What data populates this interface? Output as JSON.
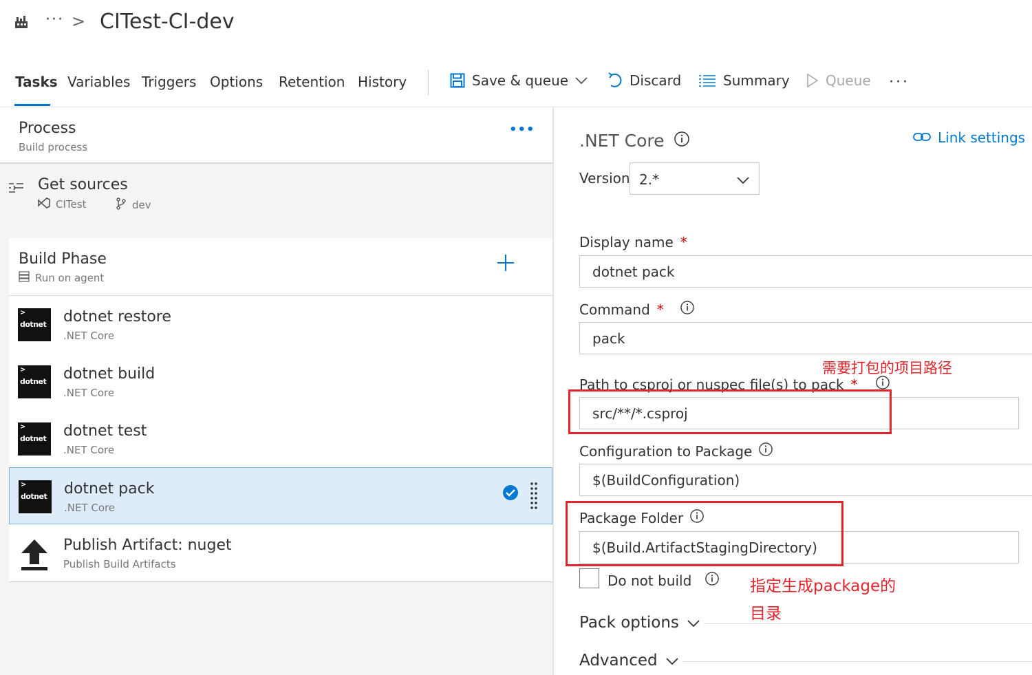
{
  "header": {
    "ellipsis": "···",
    "chevron": ">",
    "title": "CITest-CI-dev"
  },
  "tabs": [
    {
      "label": "Tasks",
      "active": true
    },
    {
      "label": "Variables"
    },
    {
      "label": "Triggers"
    },
    {
      "label": "Options"
    },
    {
      "label": "Retention"
    },
    {
      "label": "History"
    }
  ],
  "toolbar": {
    "save_queue": "Save & queue",
    "discard": "Discard",
    "summary": "Summary",
    "queue": "Queue",
    "more": "···"
  },
  "process": {
    "title": "Process",
    "subtitle": "Build process",
    "more": "•••"
  },
  "sources": {
    "title": "Get sources",
    "repo": "CITest",
    "branch": "dev"
  },
  "phase": {
    "title": "Build Phase",
    "subtitle": "Run on agent"
  },
  "tasks": [
    {
      "name": "dotnet restore",
      "type": ".NET Core",
      "icon_label": "dotnet"
    },
    {
      "name": "dotnet build",
      "type": ".NET Core",
      "icon_label": "dotnet"
    },
    {
      "name": "dotnet test",
      "type": ".NET Core",
      "icon_label": "dotnet"
    },
    {
      "name": "dotnet pack",
      "type": ".NET Core",
      "icon_label": "dotnet",
      "selected": true
    },
    {
      "name": "Publish Artifact: nuget",
      "type": "Publish Build Artifacts",
      "icon": "upload-icon"
    }
  ],
  "details": {
    "title": ".NET Core",
    "link_settings": "Link settings",
    "version_label": "Version",
    "version_value": "2.*",
    "display_name_label": "Display name",
    "display_name_value": "dotnet pack",
    "command_label": "Command",
    "command_value": "pack",
    "path_label": "Path to csproj or nuspec file(s) to pack",
    "path_value": "src/**/*.csproj",
    "config_label": "Configuration to Package",
    "config_value": "$(BuildConfiguration)",
    "folder_label": "Package Folder",
    "folder_value": "$(Build.ArtifactStagingDirectory)",
    "do_not_build": "Do not build",
    "pack_options": "Pack options",
    "advanced": "Advanced",
    "required_mark": "*"
  },
  "annotations": {
    "path_note": "需要打包的项目路径",
    "folder_note_line1": "指定生成package的",
    "folder_note_line2": "目录"
  },
  "colors": {
    "accent": "#0078d4",
    "annotation_red": "#e0262b",
    "selected_bg": "#deecf9"
  }
}
